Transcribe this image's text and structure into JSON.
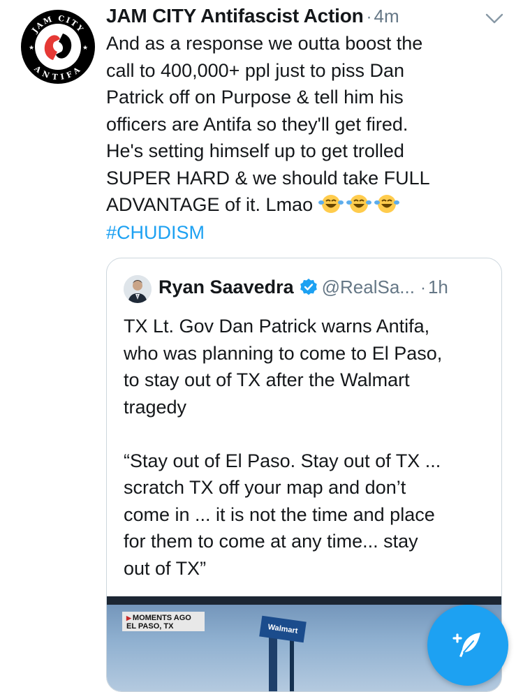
{
  "tweet": {
    "author_name": "JAM CITY Antifascist Action",
    "timestamp": "4m",
    "text": "And as a response we outta boost the\ncall to 400,000+ ppl just to piss Dan\nPatrick off on Purpose & tell him his\nofficers are Antifa so they'll get fired.\nHe's setting himself up to get trolled\nSUPER HARD & we should take FULL\nADVANTAGE of it. Lmao",
    "hashtag": "#CHUDISM",
    "avatar_text_top": "JAM CITY",
    "avatar_text_bottom": "ANTIFA"
  },
  "quote": {
    "author_name": "Ryan Saavedra",
    "handle": "@RealSa...",
    "timestamp": "1h",
    "text": "TX Lt. Gov Dan Patrick warns Antifa,\nwho was planning to come to El Paso,\nto stay out of TX after the Walmart\ntragedy\n\n“Stay out of El Paso. Stay out of TX ...\nscratch TX off your map and don’t\ncome in ... it is not the time and place\nfor them to come at any time... stay\nout of TX”",
    "media": {
      "chyron_line1": "MOMENTS AGO",
      "chyron_line2": "EL PASO, TX",
      "sign_text": "Walmart"
    }
  },
  "icons": {
    "menu": "chevron-down-icon",
    "verified": "verified-badge-icon",
    "emoji": "face-with-tears-of-joy",
    "compose": "compose-tweet-icon"
  },
  "colors": {
    "link": "#1da1f2",
    "secondary_text": "#657786",
    "antifa_red": "#e53935",
    "border": "#ccd6dd"
  }
}
